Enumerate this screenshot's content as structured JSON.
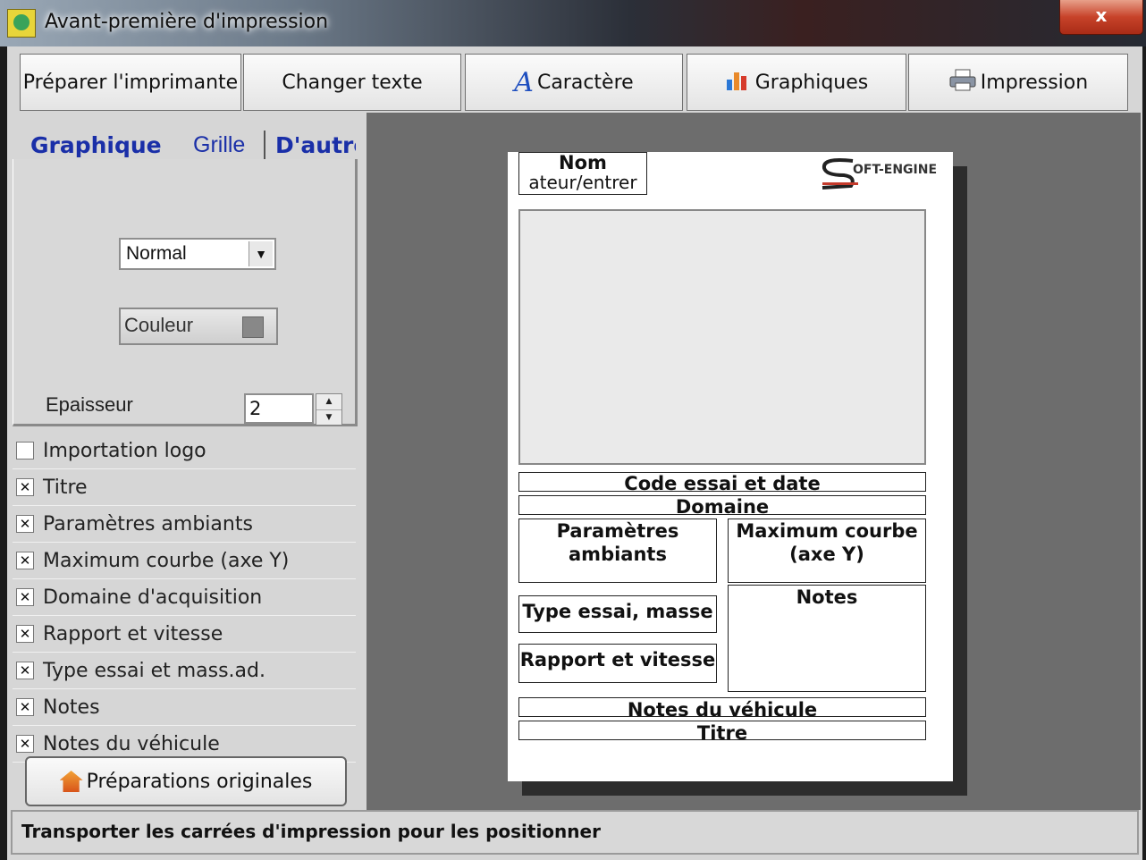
{
  "window": {
    "title": "Avant-première d'impression",
    "close_label": "x"
  },
  "toolbar": {
    "buttons": [
      {
        "label": "Préparer l'imprimante",
        "icon": ""
      },
      {
        "label": "Changer texte",
        "icon": ""
      },
      {
        "label": "Caractère",
        "icon": "font-icon"
      },
      {
        "label": "Graphiques",
        "icon": "chart-icon"
      },
      {
        "label": "Impression",
        "icon": "printer-icon"
      }
    ]
  },
  "tabs": [
    "Graphique",
    "Grille",
    "D'autre"
  ],
  "graph_settings": {
    "line_style": "Normal",
    "color_label": "Couleur",
    "color_value": "#888888",
    "thickness_label": "Epaisseur",
    "thickness_value": "2"
  },
  "checklist": [
    {
      "label": "Importation logo",
      "checked": false
    },
    {
      "label": "Titre",
      "checked": true
    },
    {
      "label": "Paramètres ambiants",
      "checked": true
    },
    {
      "label": "Maximum courbe (axe Y)",
      "checked": true
    },
    {
      "label": "Domaine d'acquisition",
      "checked": true
    },
    {
      "label": "Rapport et vitesse",
      "checked": true
    },
    {
      "label": "Type essai et mass.ad.",
      "checked": true
    },
    {
      "label": "Notes",
      "checked": true
    },
    {
      "label": "Notes du véhicule",
      "checked": true
    }
  ],
  "reset_button": {
    "label": "Préparations originales"
  },
  "preview": {
    "name_box_line1": "Nom",
    "name_box_line2": "ateur/entrer",
    "logo_text": "OFT-ENGINE",
    "code_box": "Code essai et date",
    "domain_box": "Domaine",
    "params_box_line1": "Paramètres",
    "params_box_line2": "ambiants",
    "max_box_line1": "Maximum courbe",
    "max_box_line2": "(axe Y)",
    "type_box": "Type essai, masse",
    "notes_box": "Notes",
    "rapport_box": "Rapport et vitesse",
    "vehicle_notes_box": "Notes du véhicule",
    "title_box": "Titre"
  },
  "status": {
    "text": "Transporter les carrées d'impression pour les positionner"
  }
}
